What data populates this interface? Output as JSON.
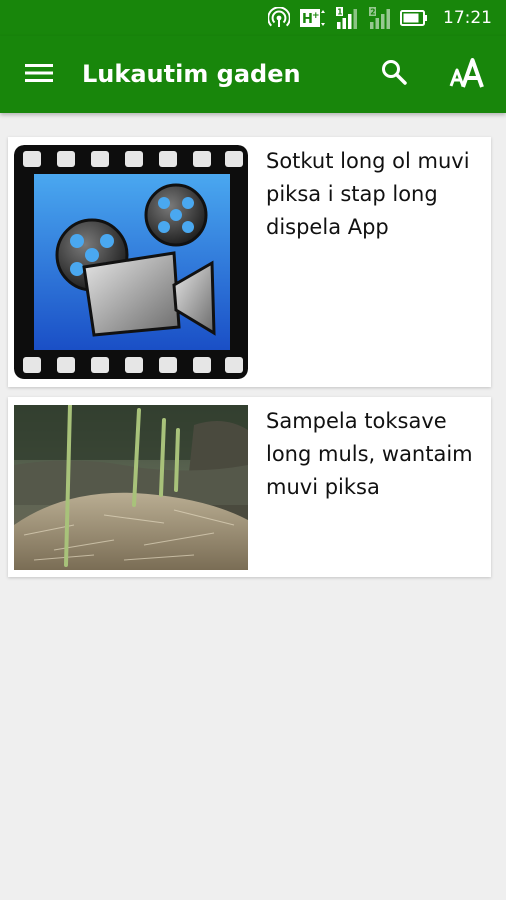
{
  "status_bar": {
    "time": "17:21",
    "icons": [
      "hotspot-icon",
      "network-hplus-icon",
      "signal-sim1-icon",
      "signal-sim2-icon",
      "battery-icon"
    ]
  },
  "app_bar": {
    "title": "Lukautim gaden",
    "menu_icon": "menu-icon",
    "search_icon": "search-icon",
    "font_size_icon": "font-size-icon",
    "background": "#18860b"
  },
  "list": {
    "items": [
      {
        "text": "Sotkut long ol muvi piksa i stap long dispela App",
        "thumbnail": "movie-camera-film-icon"
      },
      {
        "text": "Sampela toksave long muls, wantaim muvi piksa",
        "thumbnail": "mulch-garden-photo"
      }
    ]
  }
}
